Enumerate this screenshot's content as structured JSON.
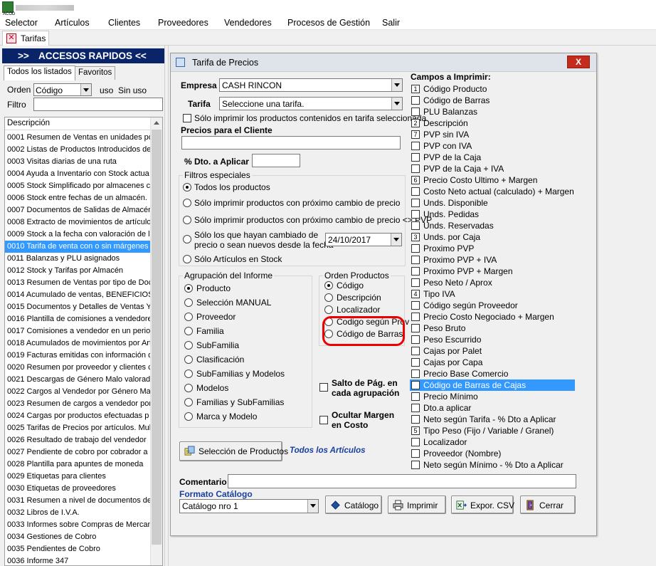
{
  "app": {
    "icon_label": "ACOD"
  },
  "menu": [
    "Selector",
    "Artículos",
    "Clientes",
    "Proveedores",
    "Vendedores",
    "Procesos de Gestión",
    "Salir"
  ],
  "tab": {
    "label": "Tarifas"
  },
  "sidebar": {
    "header_left": ">>",
    "header_title": "ACCESOS RAPIDOS",
    "header_right": "<<",
    "tabs": [
      "Todos los listados",
      "Favoritos"
    ],
    "orden_label": "Orden",
    "orden_value": "Código",
    "uso_label": "uso",
    "uso_value": "Sin uso",
    "filtro_label": "Filtro",
    "list_header": "Descripción",
    "selected_index": 9,
    "items": [
      "0001 Resumen de Ventas en unidades po",
      "0002 Listas de Productos Introducidos de",
      "0003 Visitas diarias de una ruta",
      "0004 Ayuda a Inventario con Stock actua",
      "0005 Stock Simplificado por almacenes co",
      "0006 Stock entre fechas de un almacén.",
      "0007 Documentos de Salidas de Almacén",
      "0008 Extracto de movimientos de artículos",
      "0009 Stock a la fecha con valoración de l",
      "0010 Tarifa de venta con o sin márgenes",
      "0011 Balanzas y PLU asignados",
      "0012 Stock y Tarifas por Almacén",
      "0013 Resumen de Ventas por tipo de Doc",
      "0014 Acumulado de ventas, BENEFICIOS",
      "0015 Documentos y Detalles de Ventas Y",
      "0016 Plantilla de comisiones a vendedore",
      "0017 Comisiones a vendedor en un perioc",
      "0018 Acumulados de movimientos por Art",
      "0019 Facturas emitidas con información d",
      "0020 Resumen por proveedor y clientes c",
      "0021 Descargas de Género Malo valorad",
      "0022 Cargos al Vendedor por Género Ma",
      "0023 Resumen de cargos a vendedor por",
      "0024 Cargas por productos efectuadas p",
      "0025 Tarifas de Precios por artículos. Mul",
      "0026 Resultado de trabajo del vendedor",
      "0027 Pendiente de cobro por cobrador a l",
      "0028 Plantilla para apuntes de moneda",
      "0029 Etiquetas para clientes",
      "0030 Etiquetas de proveedores",
      "0031 Resumen a nivel de documentos de",
      "0032 Libros de I.V.A.",
      "0033 Informes sobre Compras de Mercan",
      "0034 Gestiones de Cobro",
      "0035 Pendientes de Cobro",
      "0036 Informe 347"
    ]
  },
  "dialog": {
    "title": "Tarifa de Precios",
    "close_label": "X",
    "empresa_label": "Empresa",
    "empresa_value": "CASH RINCON",
    "tarifa_label": "Tarifa",
    "tarifa_value": "Seleccione una tarifa.",
    "solo_tarifa_label": "Sólo imprimir los productos contenidos en tarifa seleccionada",
    "precios_cliente_label": "Precios para el Cliente",
    "dto_label": "% Dto. a Aplicar",
    "filtros": {
      "title": "Filtros especiales",
      "options": [
        "Todos los productos",
        "Sólo imprimir productos con próximo cambio de precio",
        "Sólo imprimir productos con próximo cambio de precio <> PVP",
        "Sólo los que hayan cambiado de",
        "precio o sean nuevos desde la fecha",
        "Sólo Artículos en Stock"
      ],
      "date": "24/10/2017"
    },
    "agrupacion": {
      "title": "Agrupación del Informe",
      "options": [
        "Producto",
        "Selección MANUAL",
        "Proveedor",
        "Familia",
        "SubFamilia",
        "Clasificación",
        "SubFamilias y Modelos",
        "Modelos",
        "Familias y SubFamilias",
        "Marca y Modelo"
      ]
    },
    "orden": {
      "title": "Orden Productos",
      "options": [
        "Código",
        "Descripción",
        "Localizador",
        "Codigo según Prov",
        "Código de Barras"
      ]
    },
    "salto_label": [
      "Salto de Pág. en",
      "cada agrupación"
    ],
    "ocultar_label": [
      "Ocultar Margen",
      "en Costo"
    ],
    "seleccion_button": "Selección de Productos",
    "todos_articulos": "Todos los Artículos",
    "campos": {
      "title": "Campos a Imprimir:",
      "selected_index": 26,
      "items": [
        {
          "label": "Código Producto",
          "num": "1"
        },
        {
          "label": "Código de Barras",
          "num": ""
        },
        {
          "label": "PLU Balanzas",
          "num": ""
        },
        {
          "label": "Descripción",
          "num": "2"
        },
        {
          "label": "PVP sin IVA",
          "num": "7"
        },
        {
          "label": "PVP con IVA",
          "num": ""
        },
        {
          "label": "PVP de la Caja",
          "num": ""
        },
        {
          "label": "PVP de la Caja + IVA",
          "num": ""
        },
        {
          "label": "Precio Costo Ultimo + Margen",
          "num": "6"
        },
        {
          "label": "Costo Neto actual (calculado) + Margen",
          "num": ""
        },
        {
          "label": "Unds. Disponible",
          "num": ""
        },
        {
          "label": "Unds. Pedidas",
          "num": ""
        },
        {
          "label": "Unds. Reservadas",
          "num": ""
        },
        {
          "label": "Unds. por Caja",
          "num": "3"
        },
        {
          "label": "Proximo PVP",
          "num": ""
        },
        {
          "label": "Proximo PVP + IVA",
          "num": ""
        },
        {
          "label": "Proximo PVP + Margen",
          "num": ""
        },
        {
          "label": "Peso Neto / Aprox",
          "num": ""
        },
        {
          "label": "Tipo IVA",
          "num": "4"
        },
        {
          "label": "Código según Proveedor",
          "num": ""
        },
        {
          "label": "Precio Costo Negociado + Margen",
          "num": ""
        },
        {
          "label": "Peso Bruto",
          "num": ""
        },
        {
          "label": "Peso Escurrido",
          "num": ""
        },
        {
          "label": "Cajas por Palet",
          "num": ""
        },
        {
          "label": "Cajas por Capa",
          "num": ""
        },
        {
          "label": "Precio Base Comercio",
          "num": ""
        },
        {
          "label": "Código de Barras de Cajas",
          "num": ""
        },
        {
          "label": "Precio Mínimo",
          "num": ""
        },
        {
          "label": "Dto.a aplicar",
          "num": ""
        },
        {
          "label": "Neto según Tarifa - % Dto a Aplicar",
          "num": ""
        },
        {
          "label": "Tipo Peso (Fijo / Variable / Granel)",
          "num": "5"
        },
        {
          "label": "Localizador",
          "num": ""
        },
        {
          "label": "Proveedor (Nombre)",
          "num": ""
        },
        {
          "label": "Neto según Mínimo - % Dto a Aplicar",
          "num": ""
        }
      ]
    },
    "comentario_label": "Comentario",
    "formato_label": "Formato Catálogo",
    "formato_value": "Catálogo nro 1",
    "buttons": {
      "catalogo": "Catálogo",
      "imprimir": "Imprimir",
      "export": "Expor. CSV",
      "cerrar": "Cerrar"
    }
  },
  "colors": {
    "accent": "#0a246a",
    "selection": "#3399ff",
    "highlight": "#e00000",
    "link_text": "#1a3f9c"
  }
}
